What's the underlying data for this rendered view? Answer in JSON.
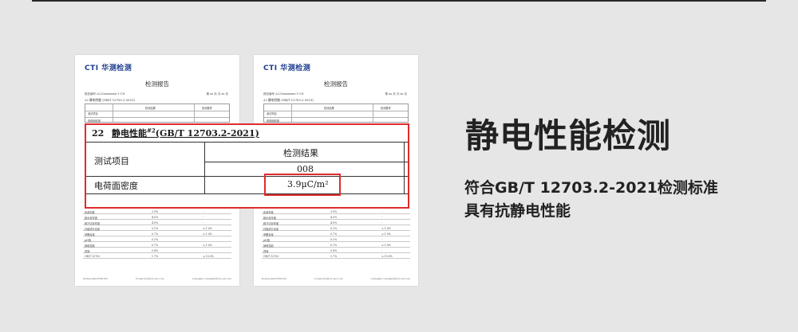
{
  "report": {
    "logo_latin": "CTI",
    "logo_cn": "华测检测",
    "title": "检测报告",
    "meta_left": "报告编号  A220xxxxxxxx-1-CH",
    "meta_right": "第 xx 页 共 xx 页",
    "sub_line": "22  静电性能 (GB/T 12703.2-2021)",
    "grid_head_left": "测试项目",
    "grid_head_mid": "检测结果",
    "grid_head_right": "检测要求",
    "grid_row_label": "电荷面密度",
    "rows": [
      [
        "色泽牢度",
        "3.9%",
        "-"
      ],
      [
        "耐水色牢度",
        "4.0%",
        "-"
      ],
      [
        "耐汗渍色牢度",
        "4.0%",
        "-"
      ],
      [
        "纤维成分含量",
        "0.1%",
        "≤ 1.0%"
      ],
      [
        "甲醛含量",
        "0.7%",
        "≤ 1.0%"
      ],
      [
        "pH值",
        "0.2%",
        "-"
      ],
      [
        "静电性能",
        "0.7%",
        "≤ 1.0%"
      ],
      [
        "异味",
        "0.4%",
        "-"
      ],
      [
        "GB/T 12703",
        "1.7%",
        "≤ 10.0%"
      ]
    ],
    "footer_left": "Hotline 400-6788-333",
    "footer_mid": "E-mail info@cti-cert.com",
    "footer_right": "Complaint complaint@cti-cert.com"
  },
  "zoom": {
    "item_no": "22",
    "title": "静电性能",
    "title_sup": "#2",
    "title_std": "(GB/T 12703.2-2021)",
    "col_item": "测试项目",
    "col_result": "检测结果",
    "sample_no": "008",
    "row_label": "电荷面密度",
    "row_value": "3.9μC/m²"
  },
  "heading": "静电性能检测",
  "description": {
    "line1": "符合GB/T 12703.2-2021检测标准",
    "line2": "具有抗静电性能"
  },
  "colors": {
    "highlight": "#e02b2b",
    "logo_blue": "#1f3e8f",
    "background": "#e6e6e6"
  }
}
